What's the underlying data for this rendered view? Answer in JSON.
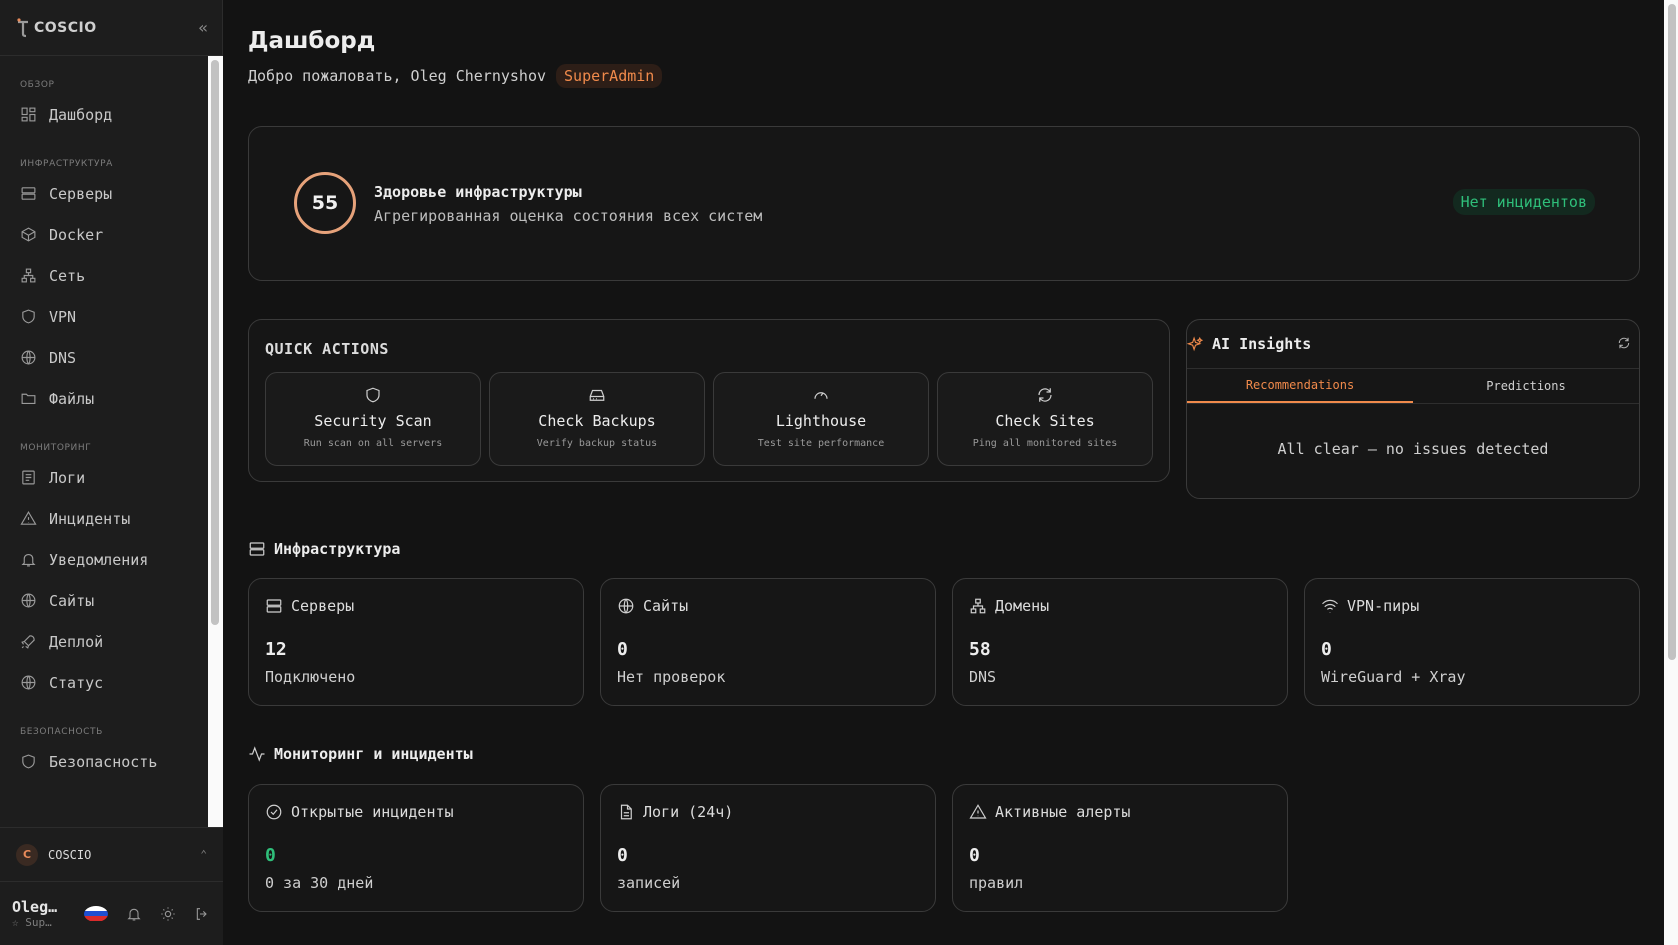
{
  "app": {
    "logo_text": "COSCIO"
  },
  "sidebar": {
    "sections": [
      {
        "title": "ОБЗОР",
        "items": [
          {
            "label": "Дашборд",
            "icon": "dashboard-icon"
          }
        ]
      },
      {
        "title": "ИНФРАСТРУКТУРА",
        "items": [
          {
            "label": "Серверы",
            "icon": "server-icon"
          },
          {
            "label": "Docker",
            "icon": "box-icon"
          },
          {
            "label": "Сеть",
            "icon": "network-icon"
          },
          {
            "label": "VPN",
            "icon": "shield-icon"
          },
          {
            "label": "DNS",
            "icon": "globe-icon"
          },
          {
            "label": "Файлы",
            "icon": "folder-icon"
          }
        ]
      },
      {
        "title": "МОНИТОРИНГ",
        "items": [
          {
            "label": "Логи",
            "icon": "logs-icon"
          },
          {
            "label": "Инциденты",
            "icon": "alert-icon"
          },
          {
            "label": "Уведомления",
            "icon": "bell-icon"
          },
          {
            "label": "Сайты",
            "icon": "globe-icon"
          },
          {
            "label": "Деплой",
            "icon": "rocket-icon"
          },
          {
            "label": "Статус",
            "icon": "globe-icon"
          }
        ]
      },
      {
        "title": "БЕЗОПАСНОСТЬ",
        "items": [
          {
            "label": "Безопасность",
            "icon": "shield-icon"
          }
        ]
      }
    ],
    "org": {
      "initial": "C",
      "name": "COSCIO"
    },
    "user": {
      "name": "Oleg…",
      "role": "☆ Sup…"
    }
  },
  "page": {
    "title": "Дашборд",
    "welcome": "Добро пожаловать, Oleg Chernyshov",
    "role_badge": "SuperAdmin"
  },
  "health": {
    "score": "55",
    "title": "Здоровье инфраструктуры",
    "subtitle": "Агрегированная оценка состояния всех систем",
    "status": "Нет инцидентов"
  },
  "quick_actions": {
    "title": "QUICK ACTIONS",
    "items": [
      {
        "label": "Security Scan",
        "sub": "Run scan on all servers"
      },
      {
        "label": "Check Backups",
        "sub": "Verify backup status"
      },
      {
        "label": "Lighthouse",
        "sub": "Test site performance"
      },
      {
        "label": "Check Sites",
        "sub": "Ping all monitored sites"
      }
    ]
  },
  "ai": {
    "title": "AI Insights",
    "tabs": [
      "Recommendations",
      "Predictions"
    ],
    "active_tab": "Recommendations",
    "empty": "All clear — no issues detected"
  },
  "infra": {
    "title": "Инфраструктура",
    "cards": [
      {
        "label": "Серверы",
        "value": "12",
        "sub": "Подключено"
      },
      {
        "label": "Сайты",
        "value": "0",
        "sub": "Нет проверок"
      },
      {
        "label": "Домены",
        "value": "58",
        "sub": "DNS"
      },
      {
        "label": "VPN-пиры",
        "value": "0",
        "sub": "WireGuard + Xray"
      }
    ]
  },
  "monitoring": {
    "title": "Мониторинг и инциденты",
    "cards": [
      {
        "label": "Открытые инциденты",
        "value": "0",
        "sub": "0 за 30 дней"
      },
      {
        "label": "Логи (24ч)",
        "value": "0",
        "sub": "записей"
      },
      {
        "label": "Активные алерты",
        "value": "0",
        "sub": "правил"
      }
    ]
  },
  "colors": {
    "accent": "#f08a4b",
    "success": "#2fbf7a",
    "bg": "#131313"
  }
}
